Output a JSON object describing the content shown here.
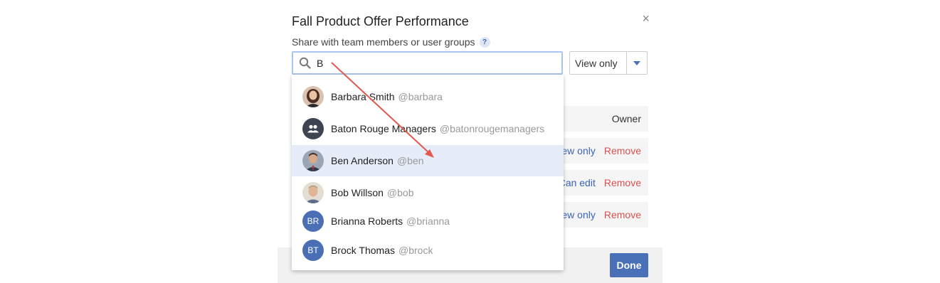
{
  "dialog": {
    "title": "Fall Product Offer Performance",
    "close_label": "×",
    "subtitle": "Share with team members or user groups",
    "help_label": "?"
  },
  "search": {
    "value": "B",
    "icon": "search-icon"
  },
  "permission": {
    "selected": "View only",
    "icon": "caret-down-icon"
  },
  "shared_rows": [
    {
      "role": "Owner"
    },
    {
      "role": "View only",
      "action": "Remove"
    },
    {
      "role": "Can edit",
      "action": "Remove"
    },
    {
      "role": "View only",
      "action": "Remove"
    }
  ],
  "suggestions": [
    {
      "name": "Barbara Smith",
      "handle": "@barbara",
      "avatar": "photo"
    },
    {
      "name": "Baton Rouge Managers",
      "handle": "@batonrougemanagers",
      "avatar": "group-icon"
    },
    {
      "name": "Ben Anderson",
      "handle": "@ben",
      "avatar": "photo",
      "highlighted": true
    },
    {
      "name": "Bob Willson",
      "handle": "@bob",
      "avatar": "photo"
    },
    {
      "name": "Brianna Roberts",
      "handle": "@brianna",
      "initials": "BR"
    },
    {
      "name": "Brock Thomas",
      "handle": "@brock",
      "initials": "BT"
    }
  ],
  "footer": {
    "done_label": "Done"
  },
  "colors": {
    "accent": "#4a70b8",
    "remove": "#d9534f",
    "highlight": "#e6edf8",
    "annotation_arrow": "#e05a4f"
  }
}
